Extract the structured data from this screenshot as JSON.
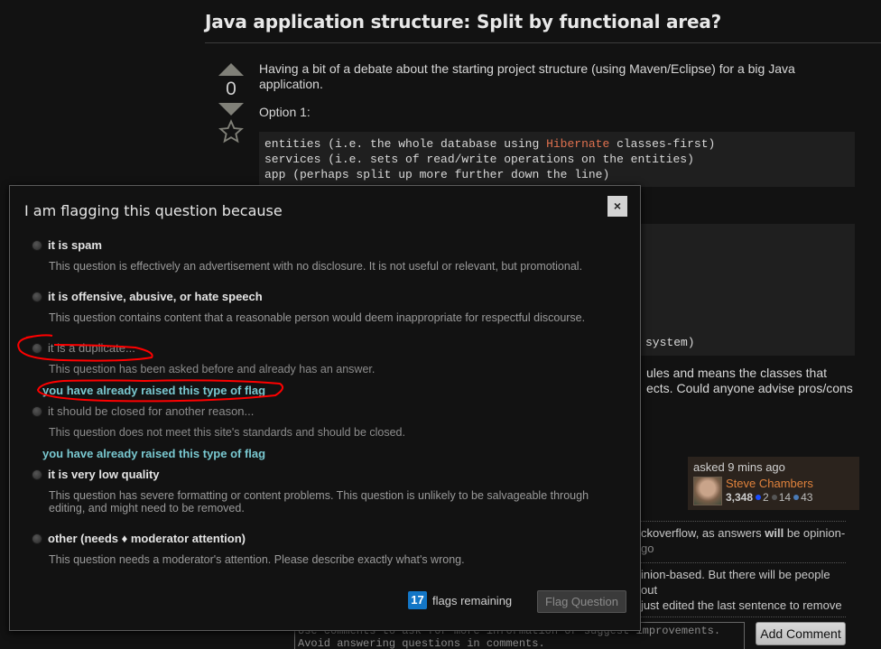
{
  "question": {
    "title": "Java application structure: Split by functional area?",
    "vote_count": "0",
    "body_p1": "Having a bit of a debate about the starting project structure (using Maven/Eclipse) for a big Java application.",
    "option1_label": "Option 1:",
    "code1": {
      "line1_pre": "entities (i.e. the whole database using ",
      "line1_highlight": "Hibernate",
      "line1_post": " classes-first)",
      "line2": "services (i.e. sets of read/write operations on the entities)",
      "line3": "app (perhaps split up more further down the line)"
    },
    "code2_tail": "system)",
    "body_tail_line1": "ules and means the classes that",
    "body_tail_line2": "ects. Could anyone advise pros/cons"
  },
  "owner": {
    "asked": "asked 9 mins ago",
    "name": "Steve Chambers",
    "reputation": "3,348",
    "gold": "2",
    "silver": "14",
    "bronze": "43",
    "colors": {
      "gold": "#1a4dff",
      "silver": "#555555",
      "bronze": "#4a7ab5"
    }
  },
  "comments": [
    {
      "text_pre": "ckoverflow, as answers ",
      "text_bold": "will",
      "text_post": " be opinion-",
      "date": "go"
    },
    {
      "line1": "inion-based. But there will be people out",
      "line2": "just edited the last sentence to remove"
    }
  ],
  "comment_box": {
    "placeholder_line1": "Use comments to ask for more information or suggest improvements.",
    "placeholder_line2": "Avoid answering questions in comments."
  },
  "add_comment_label": "Add Comment",
  "modal": {
    "title": "I am flagging this question because",
    "close_label": "×",
    "options": [
      {
        "label": "it is spam",
        "desc": "This question is effectively an advertisement with no disclosure. It is not useful or relevant, but promotional.",
        "disabled": false
      },
      {
        "label": "it is offensive, abusive, or hate speech",
        "desc": "This question contains content that a reasonable person would deem inappropriate for respectful discourse.",
        "disabled": false
      },
      {
        "label": "it is a duplicate...",
        "desc": "This question has been asked before and already has an answer.",
        "disabled": true,
        "notice": "you have already raised this type of flag"
      },
      {
        "label": "it should be closed for another reason...",
        "desc": "This question does not meet this site's standards and should be closed.",
        "disabled": true,
        "notice": "you have already raised this type of flag"
      },
      {
        "label": "it is very low quality",
        "desc": "This question has severe formatting or content problems. This question is unlikely to be salvageable through editing, and might need to be removed.",
        "disabled": false
      },
      {
        "label": "other (needs ♦ moderator attention)",
        "desc": "This question needs a moderator's attention. Please describe exactly what's wrong.",
        "disabled": false
      }
    ],
    "flags_remaining_count": "17",
    "flags_remaining_text": "flags remaining",
    "submit_label": "Flag Question",
    "badge_color": "#1376c6",
    "notice_color": "#79c8d0"
  },
  "annotation_color": "#ff0000"
}
